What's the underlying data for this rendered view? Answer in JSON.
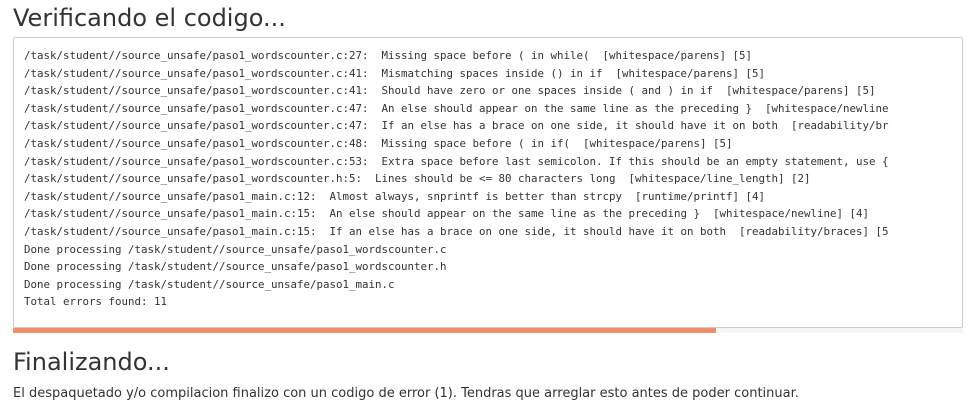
{
  "verify": {
    "title": "Verificando el codigo..."
  },
  "log": {
    "lines": [
      "/task/student//source_unsafe/paso1_wordscounter.c:27:  Missing space before ( in while(  [whitespace/parens] [5]",
      "/task/student//source_unsafe/paso1_wordscounter.c:41:  Mismatching spaces inside () in if  [whitespace/parens] [5]",
      "/task/student//source_unsafe/paso1_wordscounter.c:41:  Should have zero or one spaces inside ( and ) in if  [whitespace/parens] [5]",
      "/task/student//source_unsafe/paso1_wordscounter.c:47:  An else should appear on the same line as the preceding }  [whitespace/newline",
      "/task/student//source_unsafe/paso1_wordscounter.c:47:  If an else has a brace on one side, it should have it on both  [readability/br",
      "/task/student//source_unsafe/paso1_wordscounter.c:48:  Missing space before ( in if(  [whitespace/parens] [5]",
      "/task/student//source_unsafe/paso1_wordscounter.c:53:  Extra space before last semicolon. If this should be an empty statement, use {",
      "/task/student//source_unsafe/paso1_wordscounter.h:5:  Lines should be <= 80 characters long  [whitespace/line_length] [2]",
      "/task/student//source_unsafe/paso1_main.c:12:  Almost always, snprintf is better than strcpy  [runtime/printf] [4]",
      "/task/student//source_unsafe/paso1_main.c:15:  An else should appear on the same line as the preceding }  [whitespace/newline] [4]",
      "/task/student//source_unsafe/paso1_main.c:15:  If an else has a brace on one side, it should have it on both  [readability/braces] [5",
      "Done processing /task/student//source_unsafe/paso1_wordscounter.c",
      "Done processing /task/student//source_unsafe/paso1_wordscounter.h",
      "Done processing /task/student//source_unsafe/paso1_main.c",
      "Total errors found: 11"
    ]
  },
  "progress": {
    "fraction": 0.74,
    "color": "#ef8f6a"
  },
  "final": {
    "title": "Finalizando...",
    "message": "El despaquetado y/o compilacion finalizo con un codigo de error (1). Tendras que arreglar esto antes de poder continuar."
  }
}
